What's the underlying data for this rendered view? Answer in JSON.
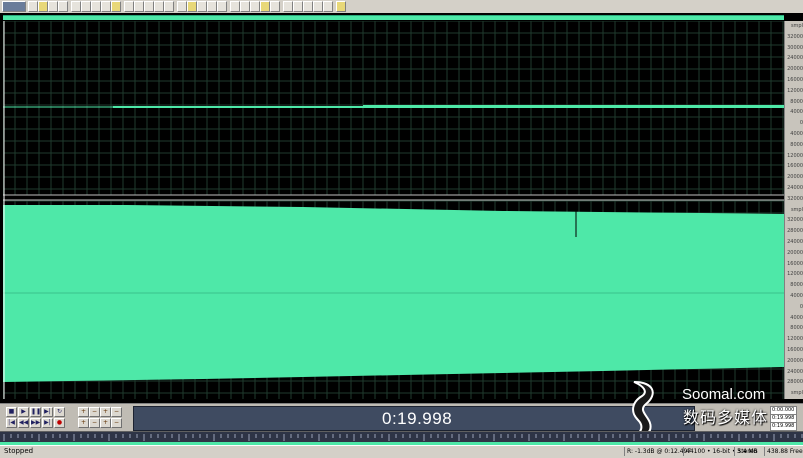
{
  "toolbar": {
    "buttons": [
      "first",
      "new",
      "open",
      "save",
      "cut",
      "copy",
      "paste",
      "mix",
      "undo",
      "redo",
      "trim",
      "silence",
      "select",
      "zoom",
      "play",
      "loop",
      "env",
      "spec",
      "cue",
      "range",
      "mark",
      "snap",
      "grid",
      "view",
      "fx",
      "meter",
      "tools",
      "help",
      "extra",
      "opt",
      "more"
    ]
  },
  "waveform": {
    "top_channel": "silent",
    "bottom_channel": "loud"
  },
  "ruler": {
    "labels": [
      "smpl",
      "32000",
      "30000",
      "24000",
      "20000",
      "16000",
      "12000",
      "8000",
      "4000",
      "0",
      "4000",
      "8000",
      "12000",
      "16000",
      "20000",
      "24000",
      "32000",
      "smpl",
      "32000",
      "28000",
      "24000",
      "20000",
      "16000",
      "12000",
      "8000",
      "4000",
      "0",
      "4000",
      "8000",
      "12000",
      "16000",
      "20000",
      "24000",
      "28000",
      "smpl"
    ]
  },
  "transport": {
    "time": "0:19.998",
    "play_buttons": [
      "stop",
      "play",
      "pause",
      "play-to-end",
      "loop"
    ],
    "nav_buttons": [
      "go-start",
      "rewind",
      "fast-forward",
      "go-end",
      "record"
    ],
    "selection": {
      "begin": "0:00.000",
      "end": "0:19.998",
      "length": "0:19.998"
    }
  },
  "watermark": {
    "site": "Soomal.com",
    "cn": "数码多媒体"
  },
  "status": {
    "left": "Stopped",
    "level": "R: -1.3dB @ 0:12.497",
    "format": "44100 • 16-bit • Stereo",
    "size": "3.4 MB",
    "free": "438.88 Free"
  },
  "colors": {
    "wave": "#4ee8a8",
    "wave_bg": "#000000",
    "grid": "#1f3a2e",
    "time_display_bg": "#3f4b61"
  }
}
